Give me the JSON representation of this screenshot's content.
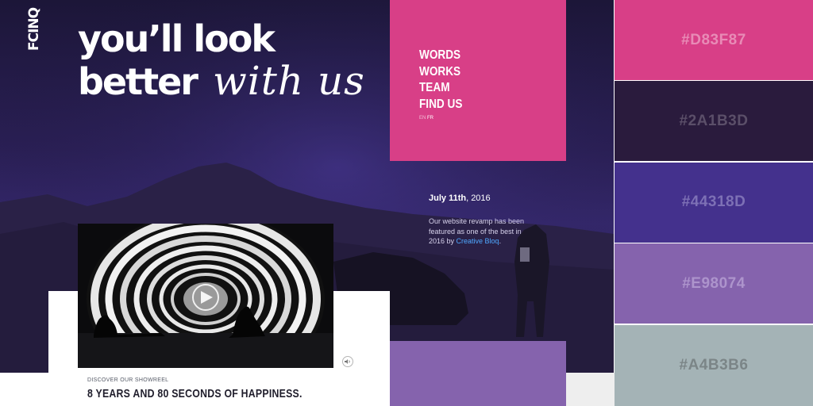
{
  "logo": "FCINQ",
  "headline": {
    "line1": "you’ll look",
    "line2": "better",
    "script": "with us"
  },
  "nav": {
    "items": [
      "WORDS",
      "WORKS",
      "TEAM",
      "FIND US"
    ],
    "languages": [
      "EN",
      "FR"
    ]
  },
  "news": {
    "date_bold": "July 11th",
    "date_rest": ", 2016",
    "text_before": "Our website revamp has been featured as one of the best in 2016 by ",
    "link": "Creative Bloq",
    "text_after": "."
  },
  "showreel": {
    "eyebrow": "DISCOVER OUR SHOWREEL",
    "title": "8 YEARS AND 80 SECONDS OF HAPPINESS."
  },
  "palette": [
    {
      "label": "#D83F87",
      "bg": "#D83F87",
      "fg": "#e88bb6"
    },
    {
      "label": "#2A1B3D",
      "bg": "#2A1B3D",
      "fg": "#5b4f69"
    },
    {
      "label": "#44318D",
      "bg": "#44318D",
      "fg": "#7d70b5"
    },
    {
      "label": "#E98074",
      "bg": "#8563ad",
      "fg": "#ad94cc"
    },
    {
      "label": "#A4B3B6",
      "bg": "#A4B3B6",
      "fg": "#7b8587"
    }
  ],
  "icons": {
    "play": "play-icon",
    "mute": "speaker-icon"
  }
}
